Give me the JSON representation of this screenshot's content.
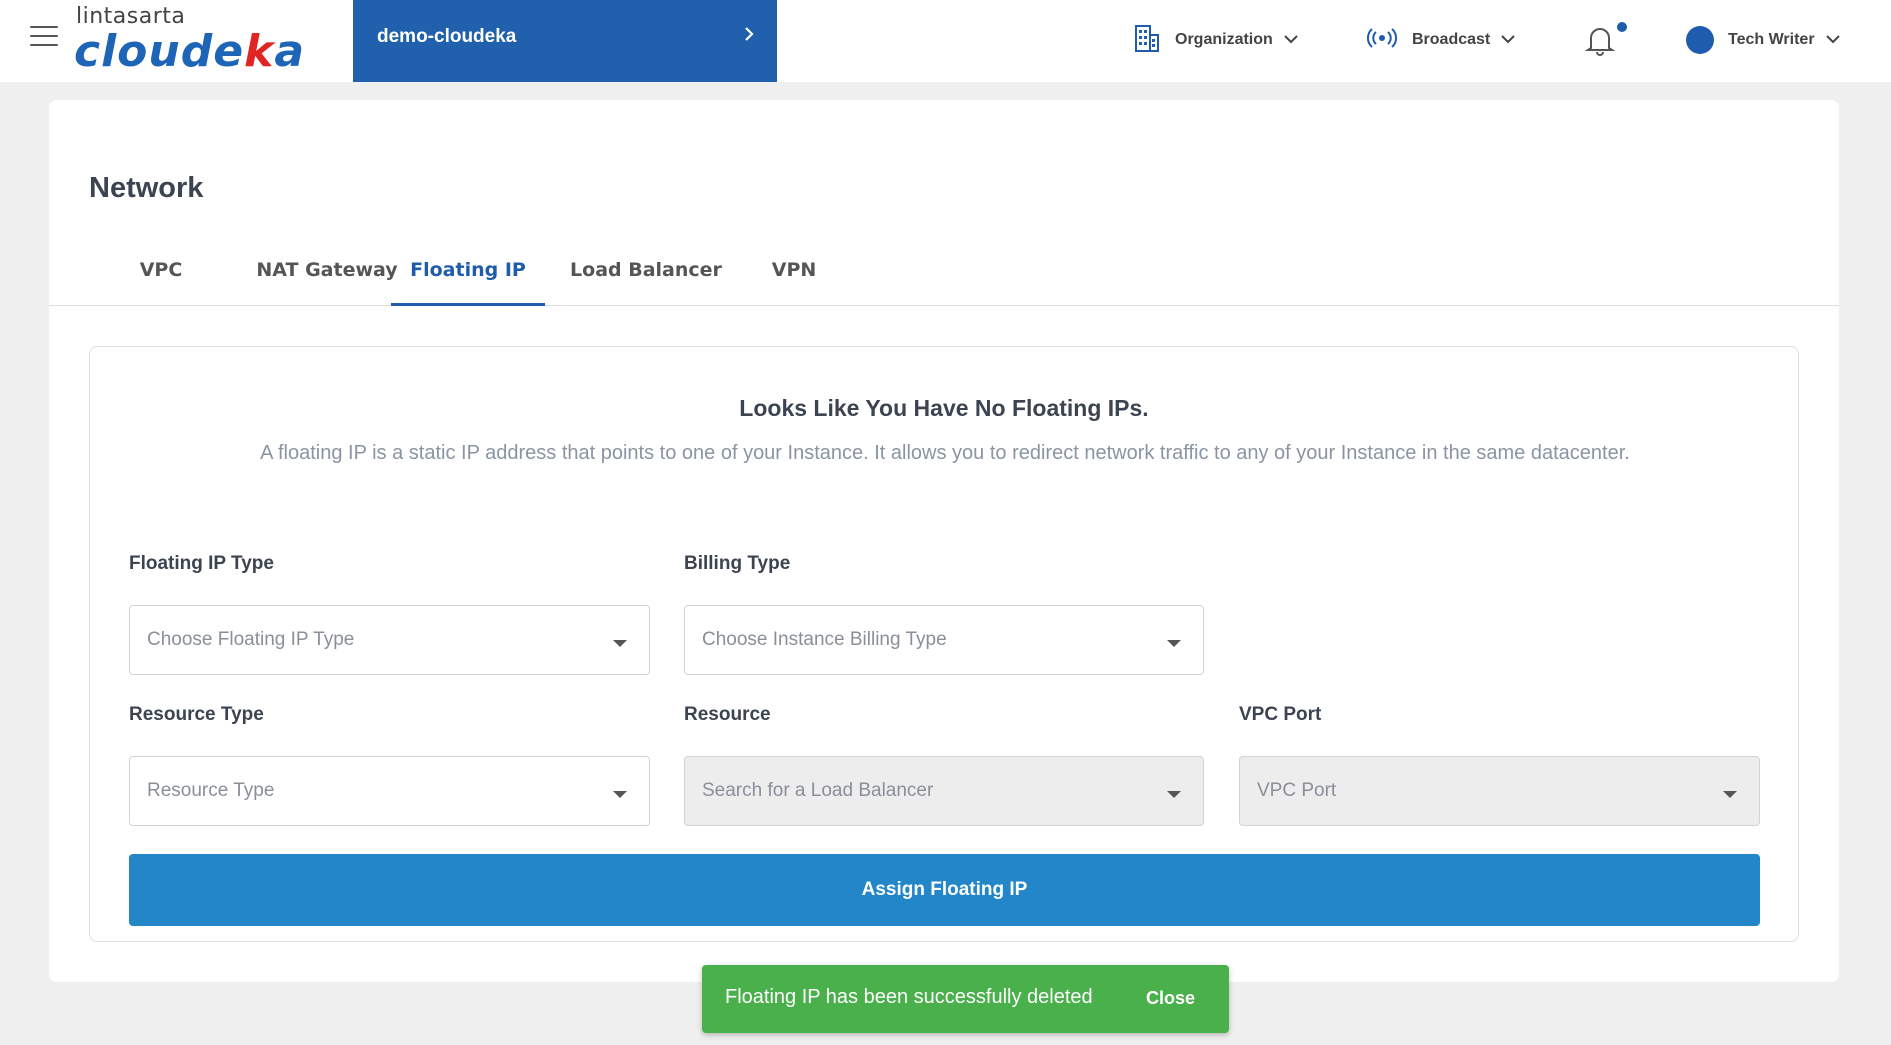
{
  "header": {
    "logo_top": "lintasarta",
    "logo_main_prefix": "cloude",
    "logo_main_k": "k",
    "logo_main_suffix": "a",
    "project": "demo-cloudeka",
    "organization": "Organization",
    "broadcast": "Broadcast",
    "user": "Tech Writer",
    "accent_color": "#2160ad"
  },
  "page": {
    "title": "Network",
    "tabs": [
      {
        "label": "VPC"
      },
      {
        "label": "NAT Gateway"
      },
      {
        "label": "Floating IP"
      },
      {
        "label": "Load Balancer"
      },
      {
        "label": "VPN"
      }
    ],
    "active_tab": "Floating IP"
  },
  "empty_state": {
    "title": "Looks Like You Have No Floating IPs.",
    "description": "A floating IP is a static IP address that points to one of your Instance. It allows you to redirect network traffic to any of your Instance in the same datacenter."
  },
  "form": {
    "floating_ip_type": {
      "label": "Floating IP Type",
      "placeholder": "Choose Floating IP Type"
    },
    "billing_type": {
      "label": "Billing Type",
      "placeholder": "Choose Instance Billing Type"
    },
    "resource_type": {
      "label": "Resource Type",
      "placeholder": "Resource Type"
    },
    "resource": {
      "label": "Resource",
      "placeholder": "Search for a Load Balancer"
    },
    "vpc_port": {
      "label": "VPC Port",
      "placeholder": "VPC Port"
    },
    "submit_label": "Assign Floating IP",
    "button_color": "#2286c9"
  },
  "toast": {
    "message": "Floating IP has been successfully deleted",
    "close_label": "Close",
    "color": "#49b04b"
  }
}
